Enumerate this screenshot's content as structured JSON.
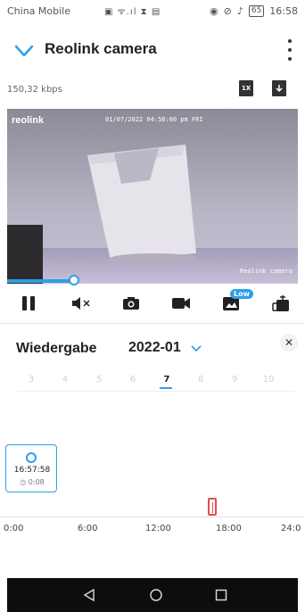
{
  "status_bar": {
    "carrier": "China Mobile",
    "battery": "65",
    "time": "16:58"
  },
  "app_bar": {
    "title": "Reolink camera"
  },
  "player": {
    "bitrate": "150,32 kbps",
    "speed": "1X",
    "overlay_logo": "reolink",
    "overlay_timestamp": "01/07/2022 04:58:00 pm FRI",
    "overlay_camera": "Reolink camera",
    "playback_progress_fraction": 0.23,
    "stream_quality_badge": "Low"
  },
  "playback": {
    "heading": "Wiedergabe",
    "month": "2022-01",
    "days": [
      "3",
      "4",
      "5",
      "6",
      "7",
      "8",
      "9",
      "10"
    ],
    "selected_day": "7"
  },
  "clip": {
    "start_time": "16:57:58",
    "duration": "0:08"
  },
  "timeline": {
    "ticks": [
      "0:00",
      "6:00",
      "12:00",
      "18:00",
      "24:0"
    ]
  },
  "colors": {
    "accent": "#2d9fe8",
    "marker": "#e94b4b"
  }
}
